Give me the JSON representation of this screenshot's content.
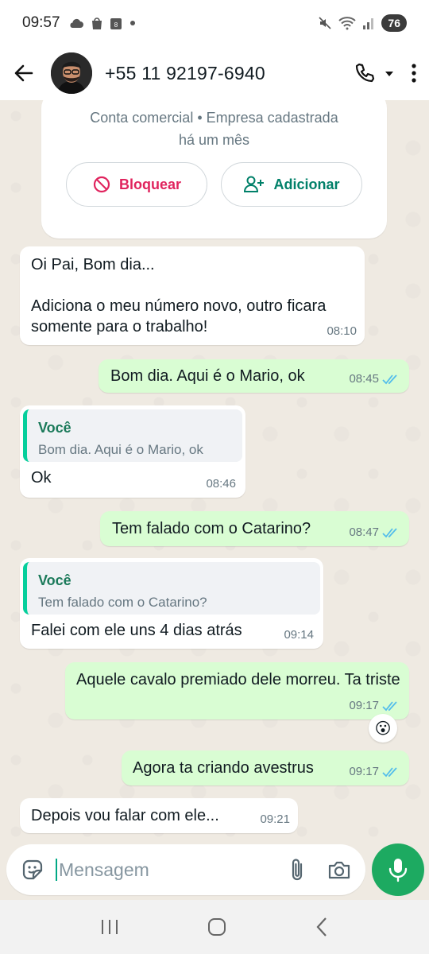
{
  "status_bar": {
    "time": "09:57",
    "battery": "76"
  },
  "header": {
    "contact": "+55 11 92197-6940"
  },
  "info_card": {
    "line1": "Conta comercial • Empresa cadastrada",
    "line2": "há um mês",
    "block_label": "Bloquear",
    "add_label": "Adicionar"
  },
  "messages": [
    {
      "dir": "in",
      "text": "Oi Pai, Bom dia...\n\nAdiciona o meu número novo, outro ficara somente para o trabalho!",
      "time": "08:10"
    },
    {
      "dir": "out",
      "text": "Bom dia. Aqui é  o Mario,  ok",
      "time": "08:45"
    },
    {
      "dir": "in",
      "quote_author": "Você",
      "quote_text": "Bom dia. Aqui é  o Mario,  ok",
      "text": "Ok",
      "time": "08:46"
    },
    {
      "dir": "out",
      "text": "Tem falado com o Catarino?",
      "time": "08:47"
    },
    {
      "dir": "in",
      "quote_author": "Você",
      "quote_text": "Tem falado com o Catarino?",
      "text": "Falei com ele uns 4 dias atrás",
      "time": "09:14"
    },
    {
      "dir": "out",
      "text": "Aquele cavalo premiado dele morreu. Ta triste",
      "time": "09:17",
      "reaction": "😮"
    },
    {
      "dir": "out",
      "text": "Agora ta criando avestrus",
      "time": "09:17"
    },
    {
      "dir": "in",
      "text": "Depois vou falar com ele...",
      "time": "09:21"
    }
  ],
  "composer": {
    "placeholder": "Mensagem"
  },
  "colors": {
    "accent": "#1daa61",
    "outgoing": "#d9fdd3",
    "incoming": "#ffffff",
    "tick_read": "#53bdeb",
    "block": "#e0245e",
    "add": "#008069"
  },
  "icons": [
    "back-arrow-icon",
    "phone-icon",
    "dropdown-icon",
    "more-vert-icon",
    "block-icon",
    "add-person-icon",
    "sticker-icon",
    "attach-icon",
    "camera-icon",
    "mic-icon",
    "double-check-icon"
  ]
}
